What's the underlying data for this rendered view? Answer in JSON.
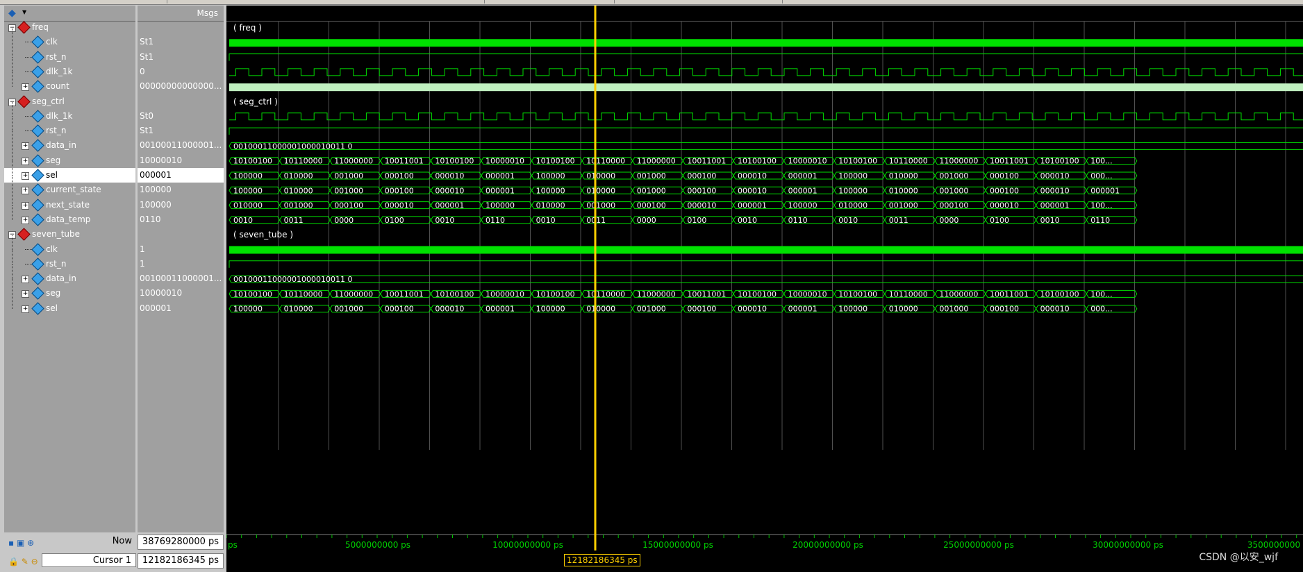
{
  "header": {
    "msgs_label": "Msgs"
  },
  "signals": [
    {
      "name": "freq",
      "kind": "group",
      "value": "",
      "group_label": "(freq)"
    },
    {
      "name": "clk",
      "kind": "bit",
      "value": "St1"
    },
    {
      "name": "rst_n",
      "kind": "bit",
      "value": "St1"
    },
    {
      "name": "dlk_1k",
      "kind": "bit",
      "value": "0"
    },
    {
      "name": "count",
      "kind": "bus",
      "value": "00000000000000..."
    },
    {
      "name": "seg_ctrl",
      "kind": "group",
      "value": "",
      "group_label": "(seg_ctrl)"
    },
    {
      "name": "dlk_1k",
      "kind": "bit",
      "value": "St0"
    },
    {
      "name": "rst_n",
      "kind": "bit",
      "value": "St1"
    },
    {
      "name": "data_in",
      "kind": "bus",
      "value": "00100011000001..."
    },
    {
      "name": "seg",
      "kind": "bus",
      "value": "10000010"
    },
    {
      "name": "sel",
      "kind": "bus",
      "value": "000001",
      "selected": true
    },
    {
      "name": "current_state",
      "kind": "bus",
      "value": "100000"
    },
    {
      "name": "next_state",
      "kind": "bus",
      "value": "100000"
    },
    {
      "name": "data_temp",
      "kind": "bus",
      "value": "0110"
    },
    {
      "name": "seven_tube",
      "kind": "group",
      "value": "",
      "group_label": "(seven_tube)"
    },
    {
      "name": "clk",
      "kind": "bit",
      "value": "1"
    },
    {
      "name": "rst_n",
      "kind": "bit",
      "value": "1"
    },
    {
      "name": "data_in",
      "kind": "bus",
      "value": "00100011000001..."
    },
    {
      "name": "seg",
      "kind": "bus",
      "value": "10000010"
    },
    {
      "name": "sel",
      "kind": "bus",
      "value": "000001"
    }
  ],
  "wave_text": {
    "data_in": "00100011000001000010011 0",
    "seg_seq": [
      "10100100",
      "10110000",
      "11000000",
      "10011001",
      "10100100",
      "10000010",
      "10100100",
      "10110000",
      "11000000",
      "10011001",
      "10100100",
      "10000010",
      "10100100",
      "10110000",
      "11000000",
      "10011001",
      "10100100",
      "100..."
    ],
    "sel_seq": [
      "100000",
      "010000",
      "001000",
      "000100",
      "000010",
      "000001",
      "100000",
      "010000",
      "001000",
      "000100",
      "000010",
      "000001",
      "100000",
      "010000",
      "001000",
      "000100",
      "000010",
      "000..."
    ],
    "current_state_seq": [
      "100000",
      "010000",
      "001000",
      "000100",
      "000010",
      "000001",
      "100000",
      "010000",
      "001000",
      "000100",
      "000010",
      "000001",
      "100000",
      "010000",
      "001000",
      "000100",
      "000010",
      "000001"
    ],
    "next_state_seq": [
      "010000",
      "001000",
      "000100",
      "000010",
      "000001",
      "100000",
      "010000",
      "001000",
      "000100",
      "000010",
      "000001",
      "100000",
      "010000",
      "001000",
      "000100",
      "000010",
      "000001",
      "100..."
    ],
    "data_temp_seq": [
      "0010",
      "0011",
      "0000",
      "0100",
      "0010",
      "0110",
      "0010",
      "0011",
      "0000",
      "0100",
      "0010",
      "0110",
      "0010",
      "0011",
      "0000",
      "0100",
      "0010",
      "0110"
    ]
  },
  "footer": {
    "now_label": "Now",
    "now_value": "38769280000 ps",
    "cursor_label": "Cursor 1",
    "cursor_value": "12182186345 ps",
    "cursor_flag": "12182186345 ps",
    "ticks": [
      "ps",
      "5000000000 ps",
      "10000000000 ps",
      "15000000000 ps",
      "20000000000 ps",
      "25000000000 ps",
      "30000000000 ps",
      "3500000000"
    ],
    "watermark": "CSDN @以安_wjf"
  },
  "colors": {
    "wave": "#00e000",
    "cursor": "#ffd000",
    "bus_text": "#ffffff"
  }
}
